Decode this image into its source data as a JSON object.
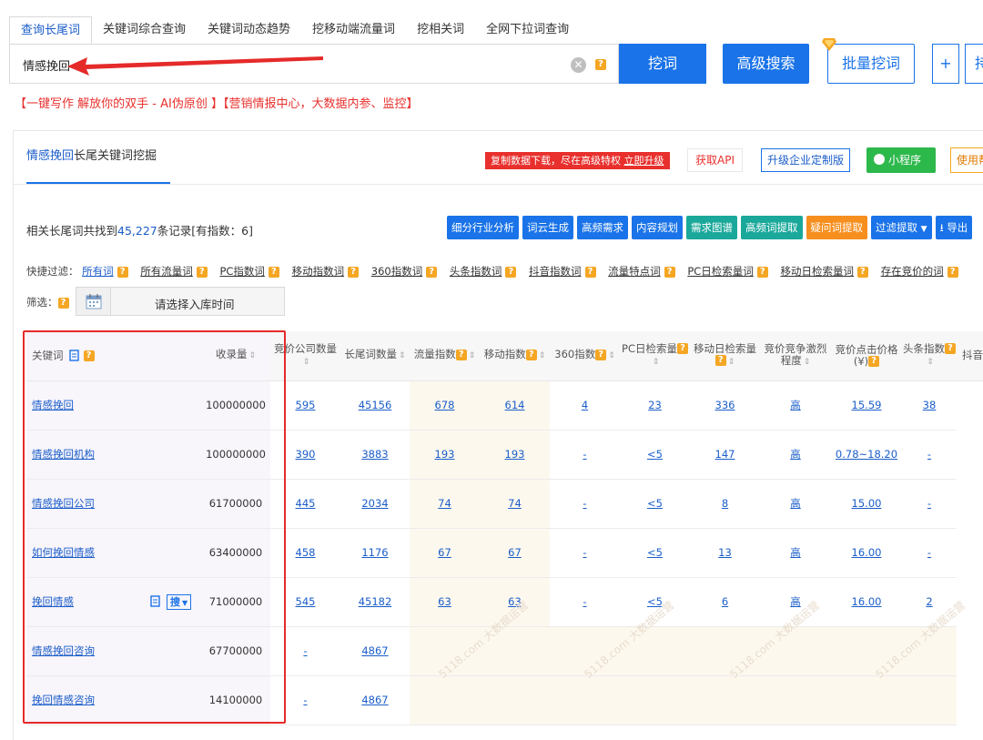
{
  "top": {
    "tabs": [
      "查询长尾词",
      "关键词综合查询",
      "关键词动态趋势",
      "挖移动端流量词",
      "挖相关词",
      "全网下拉词查询"
    ],
    "search_value": "情感挽回",
    "search_button": "挖词",
    "advanced_button": "高级搜索",
    "batch_button": "批量挖词",
    "plus_button": "+",
    "hold_button": "持",
    "promo": "【一键写作 解放你的双手 - AI伪原创 】【营销情报中心，大数据内参、监控】"
  },
  "panel": {
    "title_keyword": "情感挽回",
    "title_rest": "长尾关键词挖掘",
    "copy_tip": "复制数据下载，尽在高级特权",
    "copy_tip_link": "立即升级",
    "api_button": "获取API",
    "enterprise_button": "升级企业定制版",
    "mini_button": "小程序",
    "use_button": "使用帮"
  },
  "stats": {
    "prefix": "相关长尾词共找到",
    "count": "45,227",
    "suffix": "条记录[有指数：6]"
  },
  "tools": [
    "细分行业分析",
    "词云生成",
    "高频需求",
    "内容规划",
    "需求图谱",
    "高频词提取",
    "疑问词提取",
    "过滤提取",
    "导出"
  ],
  "quick_filter": {
    "label": "快捷过滤：",
    "items": [
      "所有词",
      "所有流量词",
      "PC指数词",
      "移动指数词",
      "360指数词",
      "头条指数词",
      "抖音指数词",
      "流量特点词",
      "PC日检索量词",
      "移动日检索量词",
      "存在竞价的词"
    ]
  },
  "date_filter": {
    "label": "筛选：",
    "placeholder": "请选择入库时间"
  },
  "table": {
    "headers": [
      "关键词",
      "收录量",
      "竞价公司数量",
      "长尾词数量",
      "流量指数",
      "移动指数",
      "360指数",
      "PC日检索量",
      "移动日检索量",
      "竞价竞争激烈程度",
      "竞价点击价格(¥)",
      "头条指数",
      "抖音指数"
    ],
    "search_tag": "搜",
    "rows": [
      {
        "kw": "情感挽回",
        "inc": "100000000",
        "bid": "595",
        "lt": "45156",
        "flow": "678",
        "mob": "614",
        "i360": "4",
        "pc": "23",
        "mday": "336",
        "comp": "高",
        "price": "15.59",
        "tt": "38"
      },
      {
        "kw": "情感挽回机构",
        "inc": "100000000",
        "bid": "390",
        "lt": "3883",
        "flow": "193",
        "mob": "193",
        "i360": "-",
        "pc": "<5",
        "mday": "147",
        "comp": "高",
        "price": "0.78~18.20",
        "tt": "-"
      },
      {
        "kw": "情感挽回公司",
        "inc": "61700000",
        "bid": "445",
        "lt": "2034",
        "flow": "74",
        "mob": "74",
        "i360": "-",
        "pc": "<5",
        "mday": "8",
        "comp": "高",
        "price": "15.00",
        "tt": "-"
      },
      {
        "kw": "如何挽回情感",
        "inc": "63400000",
        "bid": "458",
        "lt": "1176",
        "flow": "67",
        "mob": "67",
        "i360": "-",
        "pc": "<5",
        "mday": "13",
        "comp": "高",
        "price": "16.00",
        "tt": "-"
      },
      {
        "kw": "挽回情感",
        "inc": "71000000",
        "bid": "545",
        "lt": "45182",
        "flow": "63",
        "mob": "63",
        "i360": "-",
        "pc": "<5",
        "mday": "6",
        "comp": "高",
        "price": "16.00",
        "tt": "2"
      },
      {
        "kw": "情感挽回咨询",
        "inc": "67700000",
        "bid": "-",
        "lt": "4867",
        "flow": "",
        "mob": "",
        "i360": "",
        "pc": "",
        "mday": "",
        "comp": "",
        "price": "",
        "tt": ""
      },
      {
        "kw": "挽回情感咨询",
        "inc": "14100000",
        "bid": "-",
        "lt": "4867",
        "flow": "",
        "mob": "",
        "i360": "",
        "pc": "",
        "mday": "",
        "comp": "",
        "price": "",
        "tt": ""
      }
    ]
  },
  "watermark": "5118.com 大数据运营"
}
